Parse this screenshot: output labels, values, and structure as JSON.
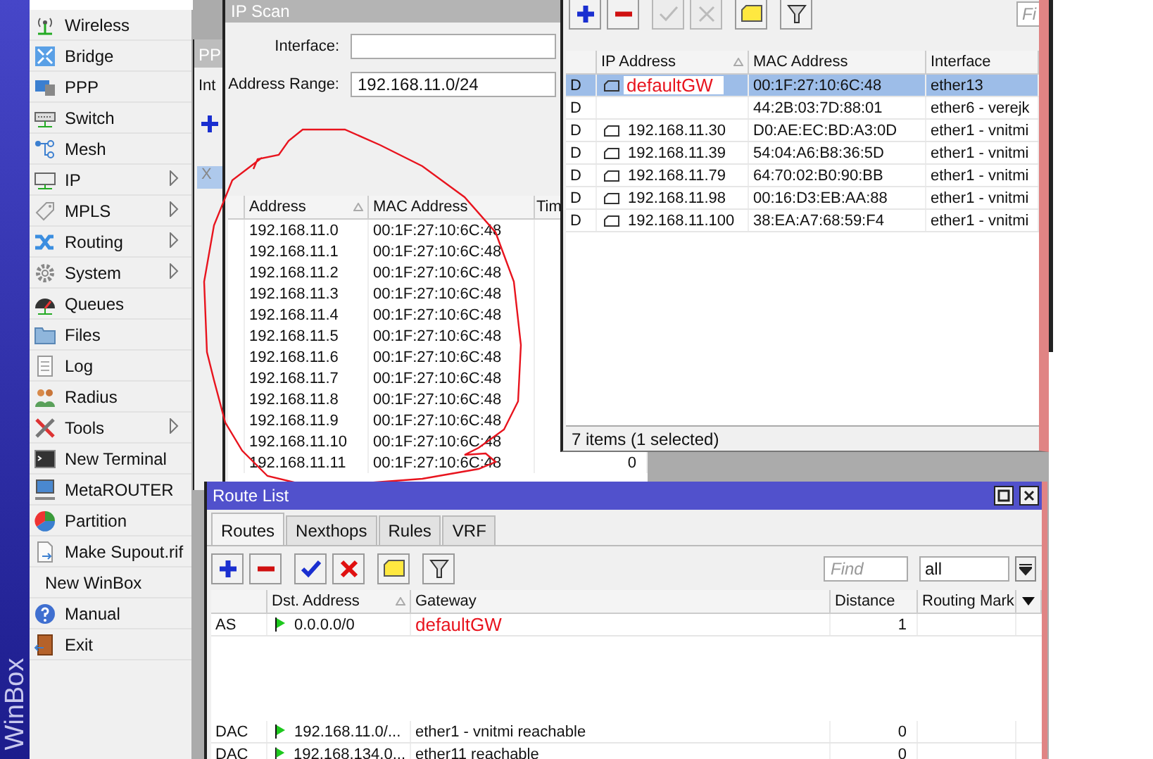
{
  "sidebar": {
    "brand": "WinBox",
    "items": [
      {
        "label": "Wireless",
        "submenu": false,
        "icon": true
      },
      {
        "label": "Bridge",
        "submenu": false,
        "icon": true
      },
      {
        "label": "PPP",
        "submenu": false,
        "icon": true
      },
      {
        "label": "Switch",
        "submenu": false,
        "icon": true
      },
      {
        "label": "Mesh",
        "submenu": false,
        "icon": true
      },
      {
        "label": "IP",
        "submenu": true,
        "icon": true
      },
      {
        "label": "MPLS",
        "submenu": true,
        "icon": true
      },
      {
        "label": "Routing",
        "submenu": true,
        "icon": true
      },
      {
        "label": "System",
        "submenu": true,
        "icon": true
      },
      {
        "label": "Queues",
        "submenu": false,
        "icon": true
      },
      {
        "label": "Files",
        "submenu": false,
        "icon": true
      },
      {
        "label": "Log",
        "submenu": false,
        "icon": true
      },
      {
        "label": "Radius",
        "submenu": false,
        "icon": true
      },
      {
        "label": "Tools",
        "submenu": true,
        "icon": true
      },
      {
        "label": "New Terminal",
        "submenu": false,
        "icon": true
      },
      {
        "label": "MetaROUTER",
        "submenu": false,
        "icon": true
      },
      {
        "label": "Partition",
        "submenu": false,
        "icon": true
      },
      {
        "label": "Make Supout.rif",
        "submenu": false,
        "icon": true
      },
      {
        "label": "New WinBox",
        "submenu": false,
        "icon": false
      },
      {
        "label": "Manual",
        "submenu": false,
        "icon": true
      },
      {
        "label": "Exit",
        "submenu": false,
        "icon": true
      }
    ]
  },
  "ppp_window": {
    "title": "PP",
    "tab": "Int",
    "row_flag": "X"
  },
  "ip_scan": {
    "title": "IP Scan",
    "fields": [
      {
        "label": "Interface:"
      },
      {
        "label": "Address Range:",
        "value": "192.168.11.0/24"
      }
    ],
    "columns": [
      "Address",
      "MAC Address",
      "Tim"
    ],
    "rows": [
      {
        "address": "192.168.11.0",
        "mac": "00:1F:27:10:6C:48"
      },
      {
        "address": "192.168.11.1",
        "mac": "00:1F:27:10:6C:48"
      },
      {
        "address": "192.168.11.2",
        "mac": "00:1F:27:10:6C:48"
      },
      {
        "address": "192.168.11.3",
        "mac": "00:1F:27:10:6C:48"
      },
      {
        "address": "192.168.11.4",
        "mac": "00:1F:27:10:6C:48"
      },
      {
        "address": "192.168.11.5",
        "mac": "00:1F:27:10:6C:48"
      },
      {
        "address": "192.168.11.6",
        "mac": "00:1F:27:10:6C:48"
      },
      {
        "address": "192.168.11.7",
        "mac": "00:1F:27:10:6C:48"
      },
      {
        "address": "192.168.11.8",
        "mac": "00:1F:27:10:6C:48"
      },
      {
        "address": "192.168.11.9",
        "mac": "00:1F:27:10:6C:48"
      },
      {
        "address": "192.168.11.10",
        "mac": "00:1F:27:10:6C:48"
      },
      {
        "address": "192.168.11.11",
        "mac": "00:1F:27:10:6C:48",
        "column_3": "0"
      }
    ]
  },
  "arp_list": {
    "toolbar": [
      {
        "kind": "add",
        "disabled": false
      },
      {
        "kind": "remove",
        "disabled": false
      },
      {
        "kind": "enable",
        "disabled": true
      },
      {
        "kind": "disable",
        "disabled": true
      },
      {
        "kind": "comment",
        "disabled": false
      },
      {
        "kind": "filter",
        "disabled": false
      }
    ],
    "find_placeholder": "Fi",
    "columns": [
      "IP Address",
      "MAC Address",
      "Interface"
    ],
    "rows": [
      {
        "flag": "D",
        "ip_address": "defaultGW",
        "annotated": true,
        "mac": "00:1F:27:10:6C:48",
        "interface": "ether13",
        "selected": true
      },
      {
        "flag": "D",
        "mac": "44:2B:03:7D:88:01",
        "interface": "ether6 - verejk",
        "selected": false
      },
      {
        "flag": "D",
        "ip_address": "192.168.11.30",
        "annotated": false,
        "mac": "D0:AE:EC:BD:A3:0D",
        "interface": "ether1 - vnitmi",
        "selected": false
      },
      {
        "flag": "D",
        "ip_address": "192.168.11.39",
        "annotated": false,
        "mac": "54:04:A6:B8:36:5D",
        "interface": "ether1 - vnitmi",
        "selected": false
      },
      {
        "flag": "D",
        "ip_address": "192.168.11.79",
        "annotated": false,
        "mac": "64:70:02:B0:90:BB",
        "interface": "ether1 - vnitmi",
        "selected": false
      },
      {
        "flag": "D",
        "ip_address": "192.168.11.98",
        "annotated": false,
        "mac": "00:16:D3:EB:AA:88",
        "interface": "ether1 - vnitmi",
        "selected": false
      },
      {
        "flag": "D",
        "ip_address": "192.168.11.100",
        "annotated": false,
        "mac": "38:EA:A7:68:59:F4",
        "interface": "ether1 - vnitmi",
        "selected": false
      }
    ],
    "status": "7 items (1 selected)"
  },
  "route_list": {
    "title": "Route List",
    "tabs": [
      {
        "label": "Routes",
        "selected": true
      },
      {
        "label": "Nexthops",
        "selected": false
      },
      {
        "label": "Rules",
        "selected": false
      },
      {
        "label": "VRF",
        "selected": false
      }
    ],
    "toolbar": [
      {
        "kind": "add",
        "disabled": false
      },
      {
        "kind": "remove",
        "disabled": false
      },
      {
        "kind": "enable",
        "disabled": false
      },
      {
        "kind": "disable",
        "disabled": false
      },
      {
        "kind": "comment",
        "disabled": false
      },
      {
        "kind": "filter",
        "disabled": false
      }
    ],
    "find_placeholder": "Find",
    "filter_value": "all",
    "columns": [
      "Dst. Address",
      "Gateway",
      "Distance",
      "Routing Mark"
    ],
    "rows": [
      {
        "kind": "route",
        "flags": "AS",
        "dst": "0.0.0.0/0",
        "gateway": "defaultGW",
        "annotated": true,
        "distance": "1"
      },
      {
        "kind": "erased"
      },
      {
        "kind": "route",
        "flags": "DAC",
        "dst": "192.168.11.0/...",
        "gateway": "ether1 - vnitmi reachable",
        "annotated": false,
        "distance": "0"
      },
      {
        "kind": "route",
        "flags": "DAC",
        "dst": "192.168.134.0...",
        "gateway": "ether11 reachable",
        "annotated": false,
        "distance": "0"
      }
    ]
  }
}
